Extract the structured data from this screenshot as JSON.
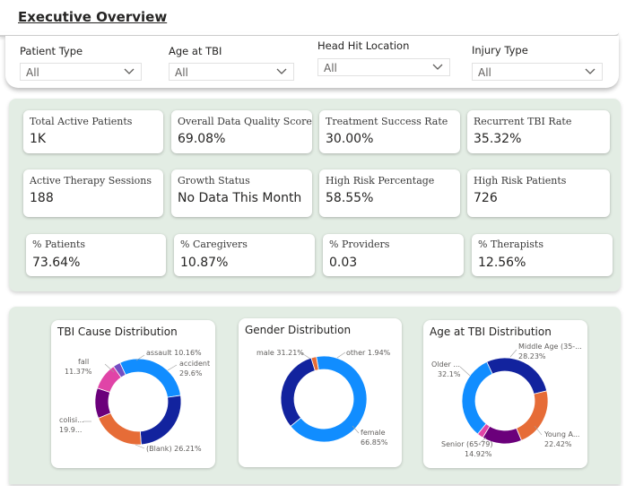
{
  "header": {
    "title": "Executive Overview"
  },
  "filters": [
    {
      "label": "Patient Type",
      "value": "All"
    },
    {
      "label": "Age at TBI",
      "value": "All"
    },
    {
      "label": "Head Hit Location",
      "value": "All"
    },
    {
      "label": "Injury Type",
      "value": "All"
    }
  ],
  "kpis": [
    {
      "label": "Total Active Patients",
      "value": "1K"
    },
    {
      "label": "Overall Data Quality Score",
      "value": "69.08%"
    },
    {
      "label": "Treatment Success Rate",
      "value": "30.00%"
    },
    {
      "label": "Recurrent TBI Rate",
      "value": "35.32%"
    },
    {
      "label": "Active Therapy Sessions",
      "value": "188"
    },
    {
      "label": "Growth Status",
      "value": "No Data This Month"
    },
    {
      "label": "High Risk Percentage",
      "value": "58.55%"
    },
    {
      "label": "High Risk Patients",
      "value": "726"
    },
    {
      "label": "% Patients",
      "value": "73.64%"
    },
    {
      "label": "% Caregivers",
      "value": "10.87%"
    },
    {
      "label": "% Providers",
      "value": "0.03"
    },
    {
      "label": "% Therapists",
      "value": "12.56%"
    }
  ],
  "chart_data": [
    {
      "type": "pie",
      "title": "TBI Cause Distribution",
      "slices": [
        {
          "label": "accident",
          "pct_label": "29.6%",
          "value": 29.6,
          "color": "#118dff"
        },
        {
          "label": "(Blank)",
          "pct_label": "26.21%",
          "value": 26.21,
          "color": "#12239e"
        },
        {
          "label": "colisi...",
          "pct_label": "19.9...",
          "value": 19.9,
          "color": "#e66c37"
        },
        {
          "label": "fall",
          "pct_label": "11.37%",
          "value": 11.37,
          "color": "#6b007b"
        },
        {
          "label": "assault",
          "pct_label": "10.16%",
          "value": 10.16,
          "color": "#e044a7"
        },
        {
          "label": "",
          "pct_label": "",
          "value": 2.76,
          "color": "#744ec2"
        }
      ]
    },
    {
      "type": "pie",
      "title": "Gender Distribution",
      "slices": [
        {
          "label": "female",
          "pct_label": "66.85%",
          "value": 66.85,
          "color": "#118dff"
        },
        {
          "label": "male",
          "pct_label": "31.21%",
          "value": 31.21,
          "color": "#12239e"
        },
        {
          "label": "other",
          "pct_label": "1.94%",
          "value": 1.94,
          "color": "#e66c37"
        }
      ]
    },
    {
      "type": "pie",
      "title": "Age at TBI Distribution",
      "slices": [
        {
          "label": "Middle Age (35-...",
          "pct_label": "28.23%",
          "value": 28.23,
          "color": "#12239e"
        },
        {
          "label": "Young A...",
          "pct_label": "22.42%",
          "value": 22.42,
          "color": "#e66c37"
        },
        {
          "label": "Senior (65-79)",
          "pct_label": "14.92%",
          "value": 14.92,
          "color": "#6b007b"
        },
        {
          "label": "",
          "pct_label": "",
          "value": 2.33,
          "color": "#e044a7"
        },
        {
          "label": "Older ...",
          "pct_label": "32.1%",
          "value": 32.1,
          "color": "#118dff"
        }
      ]
    }
  ]
}
